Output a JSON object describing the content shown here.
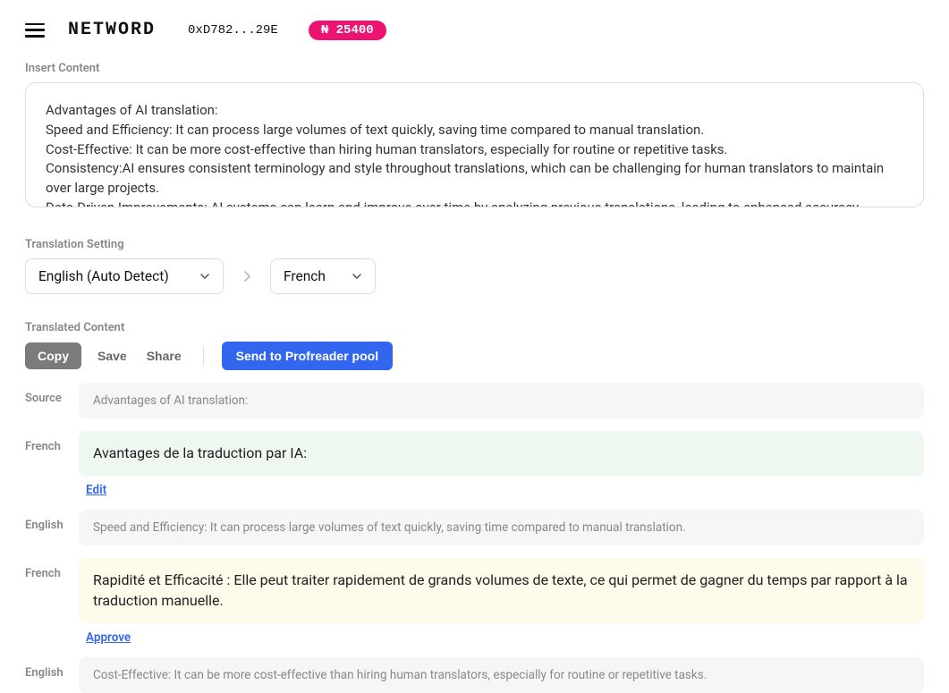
{
  "header": {
    "logo": "NETWORD",
    "wallet": "0xD782...29E",
    "badge": "₦ 25400"
  },
  "sections": {
    "insert_label": "Insert Content",
    "insert_text": "Advantages of AI translation:\nSpeed and Efficiency: It can process large volumes of text quickly, saving time compared to manual translation.\nCost-Effective: It can be more cost-effective than hiring human translators, especially for routine or repetitive tasks.\nConsistency:AI ensures consistent terminology and style throughout translations, which can be challenging for human translators to maintain over large projects.\nData-Driven Improvements: AI systems can learn and improve over time by analyzing previous translations, leading to enhanced accuracy.",
    "setting_label": "Translation Setting",
    "source_lang": "English (Auto Detect)",
    "target_lang": "French",
    "translated_label": "Translated Content"
  },
  "actions": {
    "copy": "Copy",
    "save": "Save",
    "share": "Share",
    "send": "Send to Profreader pool"
  },
  "rows": [
    {
      "label": "Source",
      "kind": "src",
      "text": "Advantages of AI translation:"
    },
    {
      "label": "French",
      "kind": "green",
      "text": "Avantages de la traduction par IA:",
      "link": "Edit"
    },
    {
      "label": "English",
      "kind": "src",
      "text": "Speed and Efficiency: It can process large volumes of text quickly, saving time compared to manual translation."
    },
    {
      "label": "French",
      "kind": "yellow",
      "text": "Rapidité et Efficacité : Elle peut traiter rapidement de grands volumes de texte, ce qui permet de gagner du temps par rapport à la traduction manuelle.",
      "link": "Approve"
    },
    {
      "label": "English",
      "kind": "src",
      "text": "Cost-Effective: It can be more cost-effective than hiring human translators, especially for routine or repetitive tasks."
    }
  ]
}
